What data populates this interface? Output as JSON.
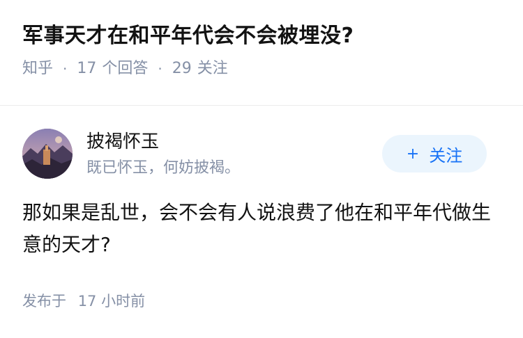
{
  "question": {
    "title": "军事天才在和平年代会不会被埋没?",
    "source": "知乎",
    "separator": "·",
    "answer_count": "17",
    "answer_label": "个回答",
    "follower_count": "29",
    "follower_label": "关注"
  },
  "author": {
    "name": "披褐怀玉",
    "bio": "既已怀玉，何妨披褐。",
    "follow_plus": "+",
    "follow_label": "关注"
  },
  "answer": {
    "text": "那如果是乱世，会不会有人说浪费了他在和平年代做生意的天才?"
  },
  "footer": {
    "posted_label": "发布于",
    "posted_time": "17 小时前"
  },
  "colors": {
    "accent": "#1772f6",
    "follow_bg": "#ebf5fd",
    "meta_gray": "#8590a6",
    "text": "#121212"
  }
}
